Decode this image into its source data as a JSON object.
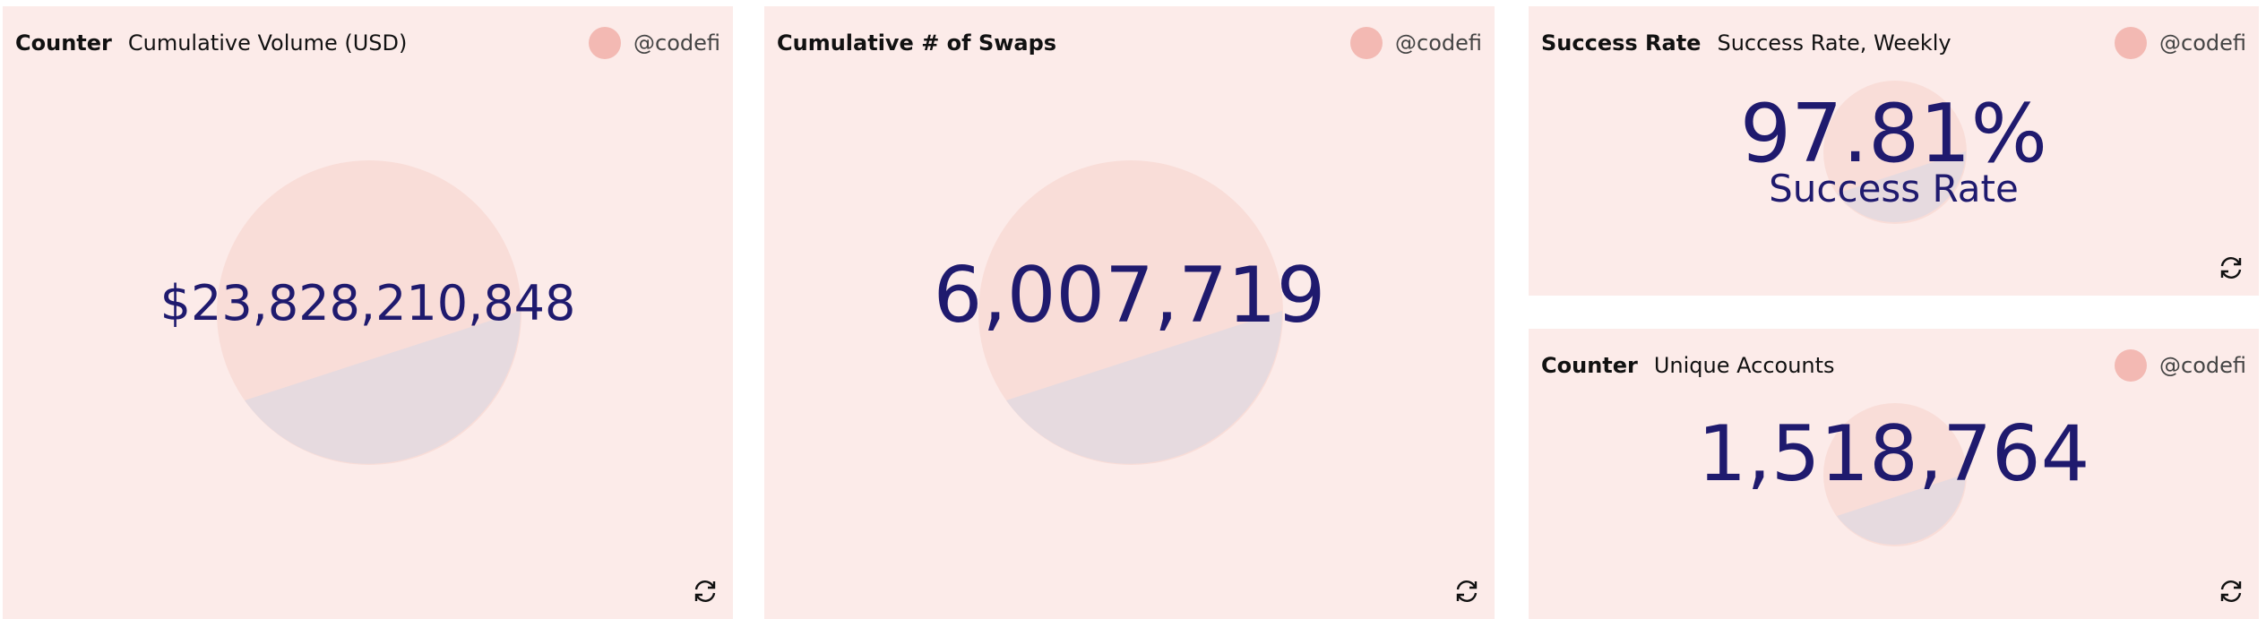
{
  "panels": [
    {
      "type_label": "Counter",
      "title": "Cumulative Volume (USD)",
      "author": "@codefi",
      "value": "$23,828,210,848"
    },
    {
      "type_label": "",
      "title": "Cumulative # of Swaps",
      "author": "@codefi",
      "value": "6,007,719"
    },
    {
      "type_label": "Success Rate",
      "title": "Success Rate, Weekly",
      "author": "@codefi",
      "value": "97.81%",
      "subtitle": "Success Rate"
    },
    {
      "type_label": "Counter",
      "title": "Unique Accounts",
      "author": "@codefi",
      "value": "1,518,764"
    }
  ],
  "icons": {
    "avatar": "avatar",
    "refresh": "refresh-icon",
    "watermark": "pie-watermark-icon"
  },
  "colors": {
    "panel_bg": "#fcebe9",
    "value_text": "#1f1a6e",
    "avatar": "#f3b9b3",
    "pie_light": "#f9ddd8",
    "pie_dark": "#e6dadf"
  }
}
